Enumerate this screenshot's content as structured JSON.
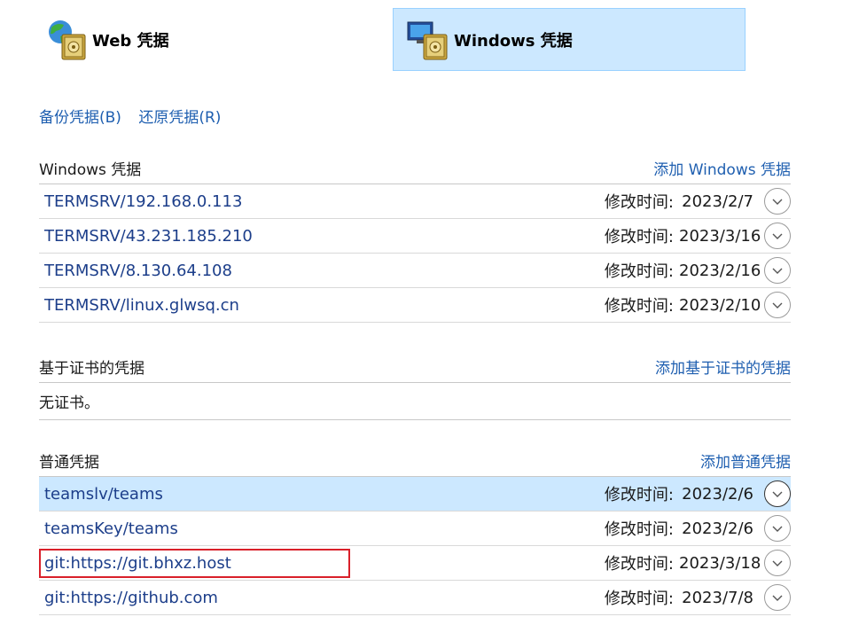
{
  "tabs": [
    {
      "label": "Web 凭据",
      "selected": false
    },
    {
      "label": "Windows 凭据",
      "selected": true
    }
  ],
  "actions": {
    "backup": "备份凭据(B)",
    "restore": "还原凭据(R)"
  },
  "windows_section": {
    "title": "Windows 凭据",
    "add": "添加 Windows 凭据",
    "items": [
      {
        "name": "TERMSRV/192.168.0.113",
        "modified_label": "修改时间:",
        "date": "2023/2/7"
      },
      {
        "name": "TERMSRV/43.231.185.210",
        "modified_label": "修改时间:",
        "date": "2023/3/16"
      },
      {
        "name": "TERMSRV/8.130.64.108",
        "modified_label": "修改时间:",
        "date": "2023/2/16"
      },
      {
        "name": "TERMSRV/linux.glwsq.cn",
        "modified_label": "修改时间:",
        "date": "2023/2/10"
      }
    ]
  },
  "cert_section": {
    "title": "基于证书的凭据",
    "add": "添加基于证书的凭据",
    "empty": "无证书。"
  },
  "generic_section": {
    "title": "普通凭据",
    "add": "添加普通凭据",
    "items": [
      {
        "name": "teamslv/teams",
        "modified_label": "修改时间:",
        "date": "2023/2/6",
        "selected": true
      },
      {
        "name": "teamsKey/teams",
        "modified_label": "修改时间:",
        "date": "2023/2/6"
      },
      {
        "name": "git:https://git.bhxz.host",
        "modified_label": "修改时间:",
        "date": "2023/3/18",
        "highlighted": true
      },
      {
        "name": "git:https://github.com",
        "modified_label": "修改时间:",
        "date": "2023/7/8"
      }
    ]
  },
  "colors": {
    "link": "#1f5fb0",
    "selection": "#cce8ff",
    "highlight_box": "#d9202a"
  }
}
